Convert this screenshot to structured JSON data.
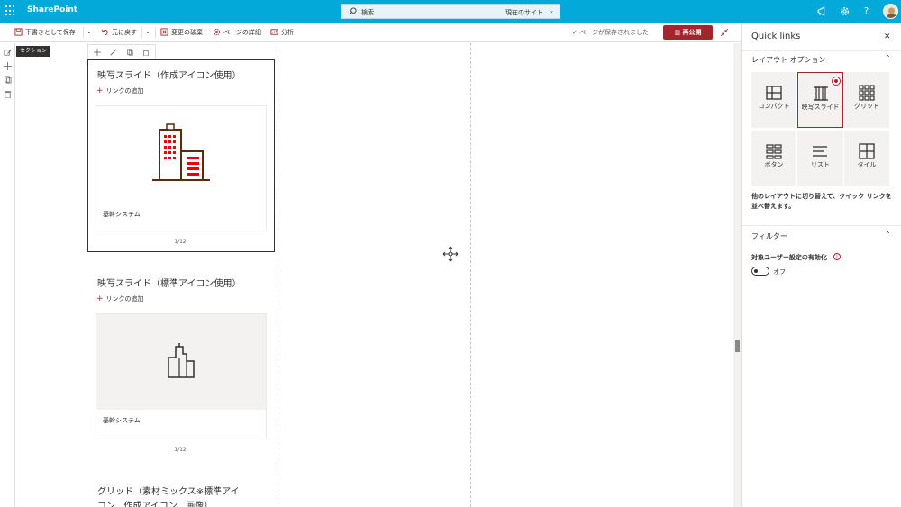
{
  "suite": {
    "brand": "SharePoint",
    "search_placeholder": "検索",
    "search_scope": "現在のサイト",
    "help": "?"
  },
  "commands": {
    "save_draft": "下書きとして保存",
    "undo": "元に戻す",
    "discard": "変更の破棄",
    "page_details": "ページの詳細",
    "analytics": "分析",
    "saved_status": "ページが保存されました",
    "republish": "再公開"
  },
  "canvas": {
    "section_tag": "セクション",
    "webparts": [
      {
        "title": "映写スライド（作成アイコン使用）",
        "add_link": "リンクの追加",
        "card_label": "基幹システム",
        "pager": "1/12"
      },
      {
        "title": "映写スライド（標準アイコン使用）",
        "add_link": "リンクの追加",
        "card_label": "基幹システム",
        "pager": "1/12"
      },
      {
        "title_line1": "グリッド（素材ミックス※標準アイ",
        "title_line2": "コン、作成アイコン、画像）"
      }
    ]
  },
  "panel": {
    "title": "Quick links",
    "layout_section": "レイアウト オプション",
    "layouts": [
      {
        "label": "コンパクト",
        "icon": "compact-icon",
        "selected": false
      },
      {
        "label": "映写スライド",
        "icon": "filmstrip-icon",
        "selected": true
      },
      {
        "label": "グリッド",
        "icon": "grid-icon",
        "selected": false
      },
      {
        "label": "ボタン",
        "icon": "button-icon",
        "selected": false
      },
      {
        "label": "リスト",
        "icon": "list-icon",
        "selected": false
      },
      {
        "label": "タイル",
        "icon": "tile-icon",
        "selected": false
      }
    ],
    "layout_description": "他のレイアウトに切り替えて、クイック リンクを並べ替えます。",
    "filter_section": "フィルター",
    "audience_label": "対象ユーザー設定の有効化",
    "audience_info": "i",
    "toggle_label": "オフ",
    "toggle_on": false
  },
  "colors": {
    "suite_bar": "#03a9d8",
    "accent": "#a4262c"
  }
}
